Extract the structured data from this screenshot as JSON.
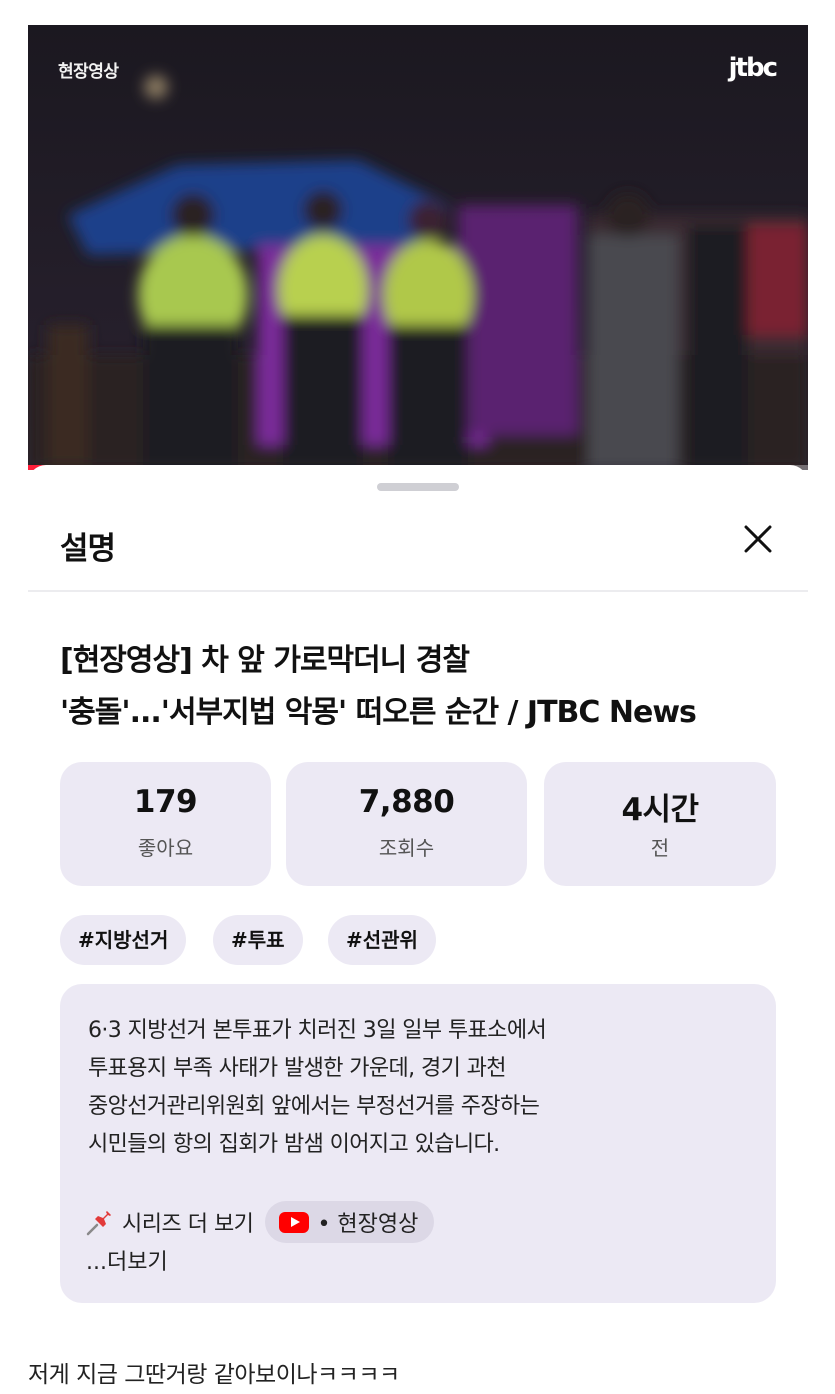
{
  "video": {
    "overlay_label": "현장영상",
    "logo": "jtbc",
    "progress_fraction": 0.83
  },
  "sheet": {
    "title": "설명",
    "close_icon": "close-icon",
    "video_title_line1": "[현장영상] 차 앞 가로막더니 경찰",
    "video_title_line2": "'충돌'...'서부지법 악몽' 떠오른 순간 / JTBC News",
    "stats": [
      {
        "value": "179",
        "label": "좋아요"
      },
      {
        "value": "7,880",
        "label": "조회수"
      },
      {
        "value": "4시간",
        "label": "전"
      }
    ],
    "tags": [
      "#지방선거",
      "#투표",
      "#선관위"
    ],
    "description": {
      "lines": [
        "6·3 지방선거 본투표가 치러진 3일 일부 투표소에서",
        "투표용지 부족 사태가 발생한 가운데, 경기 과천",
        "중앙선거관리위원회 앞에서는 부정선거를 주장하는",
        "시민들의 항의 집회가 밤샘 이어지고 있습니다."
      ],
      "series_icon": "pushpin-icon",
      "series_text": "시리즈 더 보기",
      "series_chip_icon": "youtube-icon",
      "series_chip_text": "• 현장영상",
      "more": "...더보기"
    }
  },
  "comment": "저게 지금 그딴거랑 같아보이나ㅋㅋㅋㅋ",
  "colors": {
    "card_bg": "#ece9f4",
    "progress": "#ff1f3a",
    "youtube_red": "#ff0000"
  }
}
